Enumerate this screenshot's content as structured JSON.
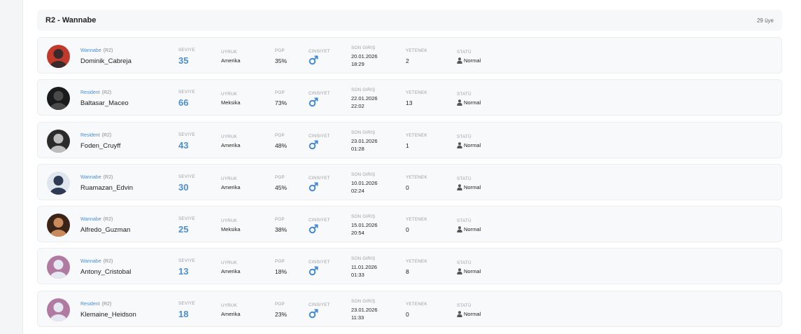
{
  "group": {
    "title": "R2 - Wannabe",
    "count": "29 üye"
  },
  "labels": {
    "level": "SEVIYE",
    "nationality": "UYRUK",
    "pop": "POP",
    "gender": "CINSIYET",
    "last_login": "SON GIRIŞ",
    "talent": "YETENEK",
    "status": "STATÜ"
  },
  "colors": {
    "accent": "#4a8fd6",
    "gender_male": "#3a84d9"
  },
  "members": [
    {
      "rank": "Wannabe",
      "rank_tag": "(R2)",
      "name": "Dominik_Cabreja",
      "level": "35",
      "nationality": "Amerika",
      "pop": "35%",
      "gender_icon": "male-icon",
      "login_date": "20.01.2026",
      "login_time": "18:29",
      "talent": "2",
      "status": "Normal",
      "avatar_colors": [
        "#c0392b",
        "#3b2a2a"
      ]
    },
    {
      "rank": "Resident",
      "rank_tag": "(R2)",
      "name": "Baltasar_Maceo",
      "level": "66",
      "nationality": "Meksika",
      "pop": "73%",
      "gender_icon": "male-icon",
      "login_date": "22.01.2026",
      "login_time": "22:02",
      "talent": "13",
      "status": "Normal",
      "avatar_colors": [
        "#1b1b1b",
        "#4a4a4a"
      ]
    },
    {
      "rank": "Resident",
      "rank_tag": "(R2)",
      "name": "Foden_Cruyff",
      "level": "43",
      "nationality": "Amerika",
      "pop": "48%",
      "gender_icon": "male-icon",
      "login_date": "23.01.2026",
      "login_time": "01:28",
      "talent": "1",
      "status": "Normal",
      "avatar_colors": [
        "#2b2b2b",
        "#bdbdbd"
      ]
    },
    {
      "rank": "Wannabe",
      "rank_tag": "(R2)",
      "name": "Ruamazan_Edvin",
      "level": "30",
      "nationality": "Amerika",
      "pop": "45%",
      "gender_icon": "male-icon",
      "login_date": "10.01.2026",
      "login_time": "02:24",
      "talent": "0",
      "status": "Normal",
      "avatar_colors": [
        "#dfe6ee",
        "#2f3b55"
      ]
    },
    {
      "rank": "Wannabe",
      "rank_tag": "(R2)",
      "name": "Alfredo_Guzman",
      "level": "25",
      "nationality": "Meksika",
      "pop": "38%",
      "gender_icon": "male-icon",
      "login_date": "15.01.2026",
      "login_time": "20:54",
      "talent": "0",
      "status": "Normal",
      "avatar_colors": [
        "#3a2418",
        "#c98a5c"
      ]
    },
    {
      "rank": "Wannabe",
      "rank_tag": "(R2)",
      "name": "Antony_Cristobal",
      "level": "13",
      "nationality": "Amerika",
      "pop": "18%",
      "gender_icon": "male-icon",
      "login_date": "11.01.2026",
      "login_time": "01:33",
      "talent": "8",
      "status": "Normal",
      "avatar_colors": [
        "#b07aa1",
        "#e5e8f2"
      ]
    },
    {
      "rank": "Resident",
      "rank_tag": "(R2)",
      "name": "Klemaine_Heidson",
      "level": "18",
      "nationality": "Amerika",
      "pop": "23%",
      "gender_icon": "male-icon",
      "login_date": "23.01.2026",
      "login_time": "11:33",
      "talent": "0",
      "status": "Normal",
      "avatar_colors": [
        "#b07aa1",
        "#e5e8f2"
      ]
    }
  ]
}
